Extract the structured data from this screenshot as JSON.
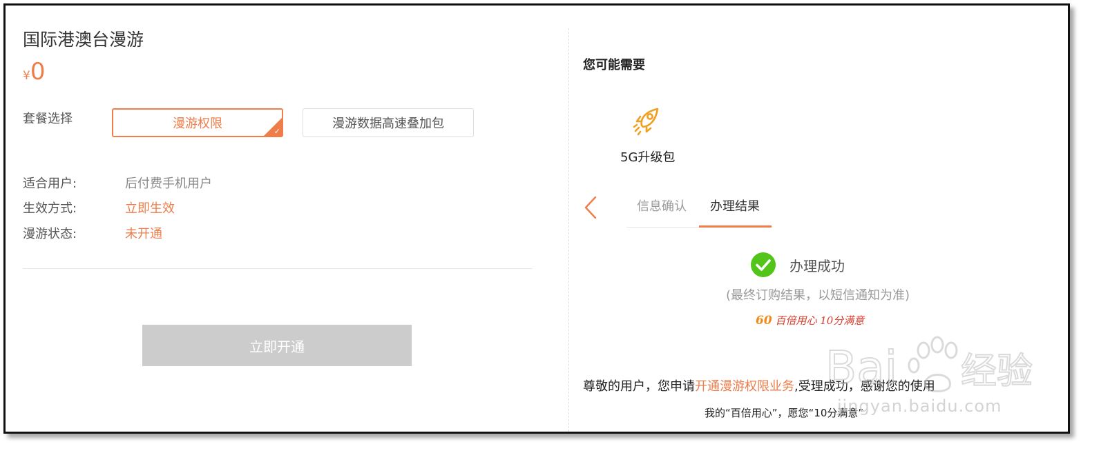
{
  "product": {
    "title": "国际港澳台漫游",
    "currency": "¥",
    "price": "0"
  },
  "package": {
    "label": "套餐选择",
    "options": [
      "漫游权限",
      "漫游数据高速叠加包"
    ],
    "selected": "漫游权限"
  },
  "info": [
    {
      "key": "适合用户:",
      "value": "后付费手机用户"
    },
    {
      "key": "生效方式:",
      "value": "立即生效"
    },
    {
      "key": "漫游状态:",
      "value": "未开通"
    }
  ],
  "open_button": "立即开通",
  "sidebar": {
    "heading": "您可能需要",
    "upgrade_label": "5G升级包",
    "upgrade_icon": "rocket-icon"
  },
  "tabs": [
    "信息确认",
    "办理结果"
  ],
  "active_tab": "办理结果",
  "result": {
    "status": "办理成功",
    "note": "(最终订购结果，以短信通知为准)",
    "slogan_num": "60",
    "slogan_text": "百倍用心 10分满意",
    "msg_prefix": "尊敬的用户，您申请",
    "msg_highlight": "开通漫游权限业务",
    "msg_suffix": ",受理成功，感谢您的使用",
    "msg_line2": "我的“百倍用心”，愿您“10分满意”"
  },
  "watermark": {
    "brand": "Baidu经验",
    "url": "jingyan.baidu.com"
  },
  "colors": {
    "accent": "#ee7d4a",
    "success": "#52c41a",
    "disabled_button": "#cccccc"
  }
}
